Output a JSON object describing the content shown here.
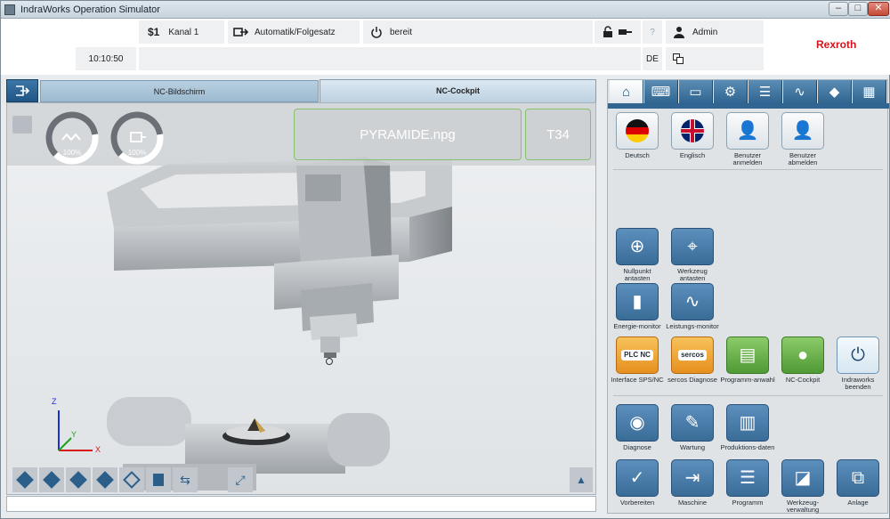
{
  "window": {
    "title": "IndraWorks Operation Simulator",
    "controls": [
      "–",
      "□",
      "✕"
    ]
  },
  "header": {
    "channel_symbol": "$1",
    "channel_name": "Kanal 1",
    "mode": "Automatik/Folgesatz",
    "status": "bereit",
    "help": "?",
    "user": "Admin",
    "time": "10:10:50",
    "language": "DE",
    "brand": "Rexroth"
  },
  "tabs": {
    "left": "NC-Bildschirm",
    "right": "NC-Cockpit"
  },
  "cockpit": {
    "gauge1_value": "100%",
    "gauge1_fraction": 0.8,
    "gauge2_value": "100%",
    "gauge2_fraction": 0.8,
    "program": "PYRAMIDE.npg",
    "tool": "T34",
    "axes": {
      "z": "Z",
      "y": "Y",
      "x": "X"
    }
  },
  "right_tabs": [
    "home-icon",
    "keyboard-icon",
    "machine-icon",
    "gear-icon",
    "checklist-icon",
    "oscilloscope-icon",
    "handshake-icon",
    "grid-icon"
  ],
  "tiles_row1": [
    {
      "label": "Deutsch",
      "icon": "german-flag-icon"
    },
    {
      "label": "Englisch",
      "icon": "uk-flag-icon"
    },
    {
      "label": "Benutzer anmelden",
      "icon": "user-login-icon"
    },
    {
      "label": "Benutzer abmelden",
      "icon": "user-logout-icon"
    }
  ],
  "tiles_row2": [
    {
      "label": "Nullpunkt antasten",
      "icon": "zero-point-icon"
    },
    {
      "label": "Werkzeug antasten",
      "icon": "tool-probe-icon"
    }
  ],
  "tiles_row3": [
    {
      "label": "Energie-monitor",
      "icon": "energy-monitor-icon"
    },
    {
      "label": "Leistungs-monitor",
      "icon": "power-monitor-icon"
    }
  ],
  "tiles_row4": [
    {
      "label": "Interface SPS/NC",
      "icon": "plc-nc-icon",
      "badge": "PLC NC"
    },
    {
      "label": "sercos Diagnose",
      "icon": "sercos-icon",
      "badge": "sercos"
    },
    {
      "label": "Programm-anwahl",
      "icon": "program-select-icon"
    },
    {
      "label": "NC-Cockpit",
      "icon": "nc-cockpit-icon"
    },
    {
      "label": "Indraworks beenden",
      "icon": "power-icon"
    }
  ],
  "tiles_row5": [
    {
      "label": "Diagnose",
      "icon": "eye-icon"
    },
    {
      "label": "Wartung",
      "icon": "wrench-icon"
    },
    {
      "label": "Produktions-daten",
      "icon": "bar-chart-icon"
    }
  ],
  "tiles_row6": [
    {
      "label": "Vorbereiten",
      "icon": "check-icon"
    },
    {
      "label": "Maschine",
      "icon": "machine-enter-icon"
    },
    {
      "label": "Programm",
      "icon": "list-icon"
    },
    {
      "label": "Werkzeug-verwaltung",
      "icon": "tool-manage-icon"
    },
    {
      "label": "Anlage",
      "icon": "plant-icon"
    }
  ]
}
